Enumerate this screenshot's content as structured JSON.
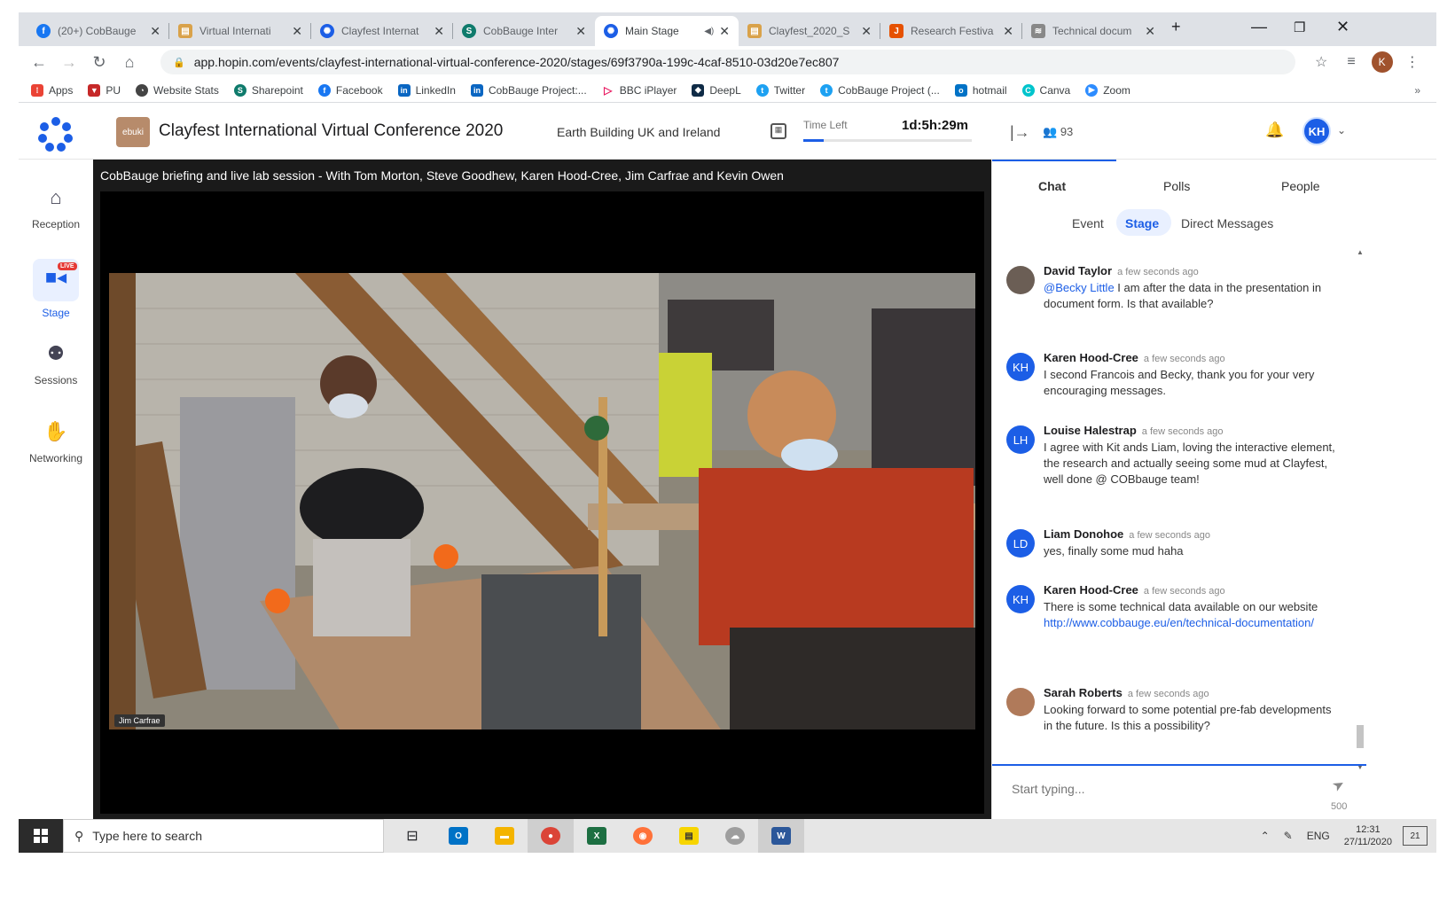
{
  "browser": {
    "tabs": [
      {
        "title": "(20+) CobBauge",
        "icon": "facebook-icon",
        "color": "#1877f2"
      },
      {
        "title": "Virtual Internati",
        "icon": "slides-icon",
        "color": "#d9a24a"
      },
      {
        "title": "Clayfest Internat",
        "icon": "hopin-icon",
        "color": "#1c5ee6"
      },
      {
        "title": "CobBauge Inter",
        "icon": "sharepoint-icon",
        "color": "#0f7b6c"
      },
      {
        "title": "Main Stage",
        "icon": "hopin-icon",
        "color": "#1c5ee6"
      },
      {
        "title": "Clayfest_2020_S",
        "icon": "slides-icon",
        "color": "#d9a24a"
      },
      {
        "title": "Research Festiva",
        "icon": "j-icon",
        "color": "#e65100"
      },
      {
        "title": "Technical docum",
        "icon": "layers-icon",
        "color": "#888888"
      }
    ],
    "url": "app.hopin.com/events/clayfest-international-virtual-conference-2020/stages/69f3790a-199c-4caf-8510-03d20e7ec807",
    "profile_initial": "K",
    "bookmarks": [
      {
        "label": "Apps",
        "icon": "apps-grid-icon",
        "color": "#ea4335"
      },
      {
        "label": "PU",
        "icon": "shield-icon",
        "color": "#c62828"
      },
      {
        "label": "Website Stats",
        "icon": "stats-icon",
        "color": "#444444"
      },
      {
        "label": "Sharepoint",
        "icon": "sharepoint-icon",
        "color": "#0f7b6c"
      },
      {
        "label": "Facebook",
        "icon": "facebook-icon",
        "color": "#1877f2"
      },
      {
        "label": "LinkedIn",
        "icon": "linkedin-icon",
        "color": "#0a66c2"
      },
      {
        "label": "CobBauge Project:...",
        "icon": "linkedin-icon",
        "color": "#0a66c2"
      },
      {
        "label": "BBC iPlayer",
        "icon": "play-icon",
        "color": "#e91e63"
      },
      {
        "label": "DeepL",
        "icon": "deepl-icon",
        "color": "#0f2b46"
      },
      {
        "label": "Twitter",
        "icon": "twitter-icon",
        "color": "#1da1f2"
      },
      {
        "label": "CobBauge Project (...",
        "icon": "twitter-icon",
        "color": "#1da1f2"
      },
      {
        "label": "hotmail",
        "icon": "outlook-icon",
        "color": "#0072c6"
      },
      {
        "label": "Canva",
        "icon": "canva-icon",
        "color": "#00c4cc"
      },
      {
        "label": "Zoom",
        "icon": "zoom-icon",
        "color": "#2d8cff"
      }
    ]
  },
  "header": {
    "org_logo_text": "ebuki",
    "event_title": "Clayfest International Virtual Conference 2020",
    "organiser": "Earth Building UK and Ireland",
    "time_left_label": "Time Left",
    "time_left_value": "1d:5h:29m",
    "time_left_fraction": 0.12,
    "attendees": "93",
    "avatar_initials": "KH"
  },
  "nav": [
    {
      "label": "Reception",
      "icon": "home-icon"
    },
    {
      "label": "Stage",
      "icon": "video-camera-icon",
      "badge": "LIVE"
    },
    {
      "label": "Sessions",
      "icon": "group-icon"
    },
    {
      "label": "Networking",
      "icon": "handshake-icon"
    }
  ],
  "stage": {
    "title": "CobBauge briefing and live lab session - With Tom Morton, Steve Goodhew, Karen Hood-Cree, Jim Carfrae and Kevin Owen",
    "speaker_tag": "Jim Carfrae"
  },
  "chat": {
    "tabs": [
      "Chat",
      "Polls",
      "People"
    ],
    "subtabs": [
      "Event",
      "Stage",
      "Direct Messages"
    ],
    "messages": [
      {
        "initials": "",
        "name": "David Taylor",
        "time": "a few seconds ago",
        "mention": "@Becky Little",
        "text": " I am after the data in the presentation in document form. Is that available?",
        "link": ""
      },
      {
        "initials": "KH",
        "name": "Karen Hood-Cree",
        "time": "a few seconds ago",
        "mention": "",
        "text": "I second Francois and Becky, thank you for your very encouraging messages.",
        "link": ""
      },
      {
        "initials": "LH",
        "name": "Louise Halestrap",
        "time": "a few seconds ago",
        "mention": "",
        "text": "I agree with Kit ands Liam, loving the interactive element, the research and actually seeing some mud at Clayfest, well done @ COBbauge team!",
        "link": ""
      },
      {
        "initials": "LD",
        "name": "Liam Donohoe",
        "time": "a few seconds ago",
        "mention": "",
        "text": "yes, finally some mud haha",
        "link": ""
      },
      {
        "initials": "KH",
        "name": "Karen Hood-Cree",
        "time": "a few seconds ago",
        "mention": "",
        "text": "There is some technical data available on our website",
        "link": "http://www.cobbauge.eu/en/technical-documentation/"
      },
      {
        "initials": "",
        "name": "Sarah Roberts",
        "time": "a few seconds ago",
        "mention": "",
        "text": "Looking forward to some potential pre-fab developments in the future. Is this a possibility?",
        "link": ""
      }
    ],
    "input_placeholder": "Start typing...",
    "char_limit": "500"
  },
  "taskbar": {
    "search_placeholder": "Type here to search",
    "language": "ENG",
    "time": "12:31",
    "date": "27/11/2020",
    "notifications": "21"
  }
}
